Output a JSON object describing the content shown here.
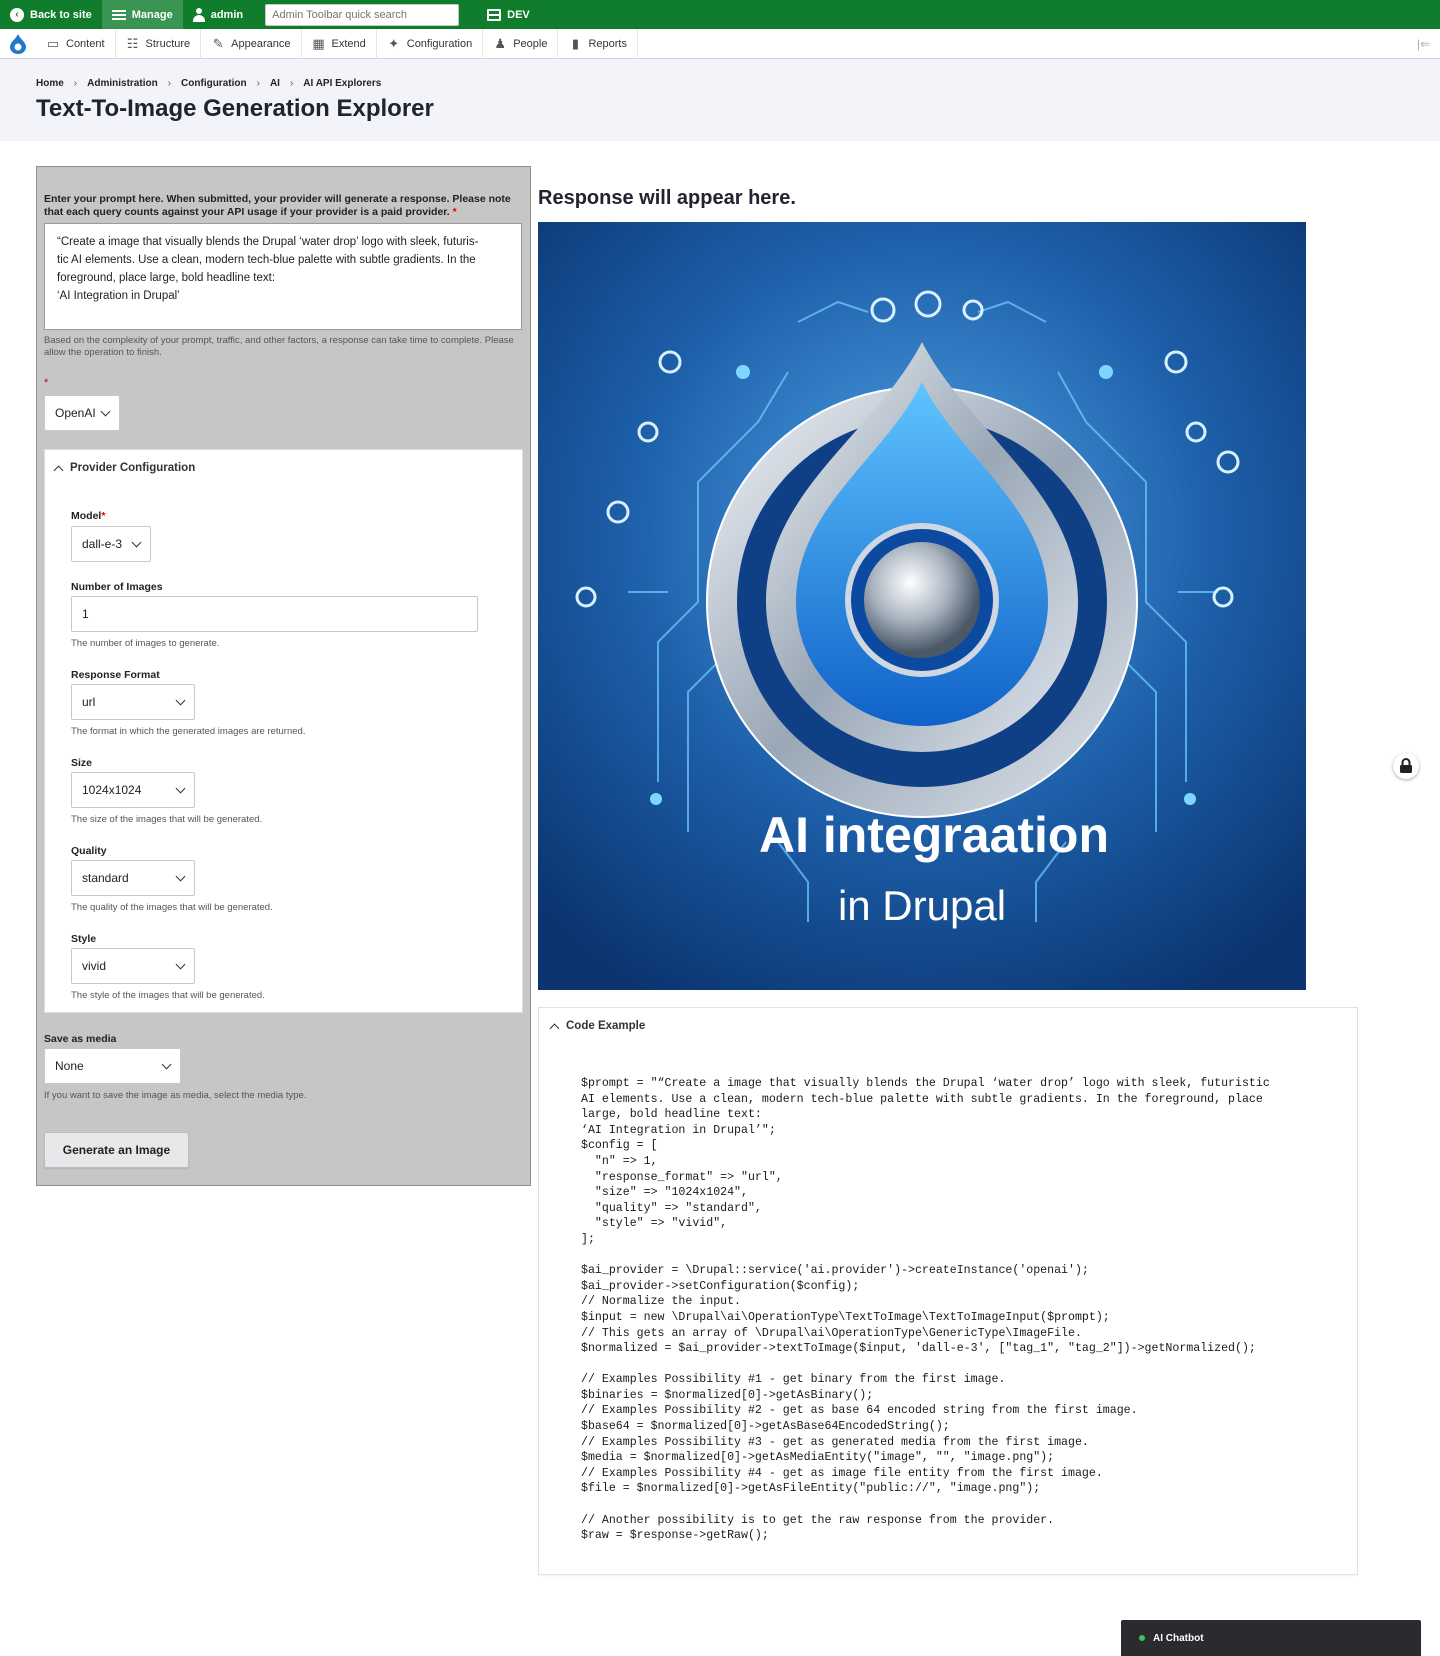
{
  "toolbar": {
    "back_label": "Back to site",
    "manage_label": "Manage",
    "user_label": "admin",
    "search_placeholder": "Admin Toolbar quick search",
    "env_label": "DEV"
  },
  "menu": {
    "items": [
      {
        "label": "Content",
        "icon": "document-icon"
      },
      {
        "label": "Structure",
        "icon": "structure-icon"
      },
      {
        "label": "Appearance",
        "icon": "wrench-brush-icon"
      },
      {
        "label": "Extend",
        "icon": "puzzle-icon"
      },
      {
        "label": "Configuration",
        "icon": "wrench-icon"
      },
      {
        "label": "People",
        "icon": "people-icon"
      },
      {
        "label": "Reports",
        "icon": "bar-chart-icon"
      }
    ]
  },
  "breadcrumb": [
    "Home",
    "Administration",
    "Configuration",
    "AI",
    "AI API Explorers"
  ],
  "page": {
    "title": "Text-To-Image Generation Explorer"
  },
  "form": {
    "prompt_label": "Enter your prompt here. When submitted, your provider will generate a response. Please note that each query counts against your API usage if your provider is a paid provider.",
    "prompt_value": "“Create a image that visually blends the Drupal ‘water drop’ logo with sleek, futuris-\ntic AI elements. Use a clean, modern tech-blue palette with subtle gradients. In the\nforeground, place large, bold headline text:\n‘AI Integration in Drupal’",
    "prompt_help": "Based on the complexity of your prompt, traffic, and other factors, a response can take time to complete. Please allow the operation to finish.",
    "provider_value": "OpenAI",
    "provider_config_label": "Provider Configuration",
    "model_label": "Model",
    "model_value": "dall-e-3",
    "num_images_label": "Number of Images",
    "num_images_value": "1",
    "num_images_help": "The number of images to generate.",
    "response_format_label": "Response Format",
    "response_format_value": "url",
    "response_format_help": "The format in which the generated images are returned.",
    "size_label": "Size",
    "size_value": "1024x1024",
    "size_help": "The size of the images that will be generated.",
    "quality_label": "Quality",
    "quality_value": "standard",
    "quality_help": "The quality of the images that will be generated.",
    "style_label": "Style",
    "style_value": "vivid",
    "style_help": "The style of the images that will be generated.",
    "save_media_label": "Save as media",
    "save_media_value": "None",
    "save_media_help": "If you want to save the image as media, select the media type.",
    "generate_label": "Generate an Image"
  },
  "response": {
    "title": "Response will appear here.",
    "image_text_line1": "AI integraation",
    "image_text_line2": "in Drupal"
  },
  "code": {
    "label": "Code Example",
    "text": "$prompt = \"“Create a image that visually blends the Drupal ‘water drop’ logo with sleek, futuristic\nAI elements. Use a clean, modern tech-blue palette with subtle gradients. In the foreground, place\nlarge, bold headline text:\n‘AI Integration in Drupal’\";\n$config = [\n  \"n\" => 1,\n  \"response_format\" => \"url\",\n  \"size\" => \"1024x1024\",\n  \"quality\" => \"standard\",\n  \"style\" => \"vivid\",\n];\n\n$ai_provider = \\Drupal::service('ai.provider')->createInstance('openai');\n$ai_provider->setConfiguration($config);\n// Normalize the input.\n$input = new \\Drupal\\ai\\OperationType\\TextToImage\\TextToImageInput($prompt);\n// This gets an array of \\Drupal\\ai\\OperationType\\GenericType\\ImageFile.\n$normalized = $ai_provider->textToImage($input, 'dall-e-3', [\"tag_1\", \"tag_2\"])->getNormalized();\n\n// Examples Possibility #1 - get binary from the first image.\n$binaries = $normalized[0]->getAsBinary();\n// Examples Possibility #2 - get as base 64 encoded string from the first image.\n$base64 = $normalized[0]->getAsBase64EncodedString();\n// Examples Possibility #3 - get as generated media from the first image.\n$media = $normalized[0]->getAsMediaEntity(\"image\", \"\", \"image.png\");\n// Examples Possibility #4 - get as image file entity from the first image.\n$file = $normalized[0]->getAsFileEntity(\"public://\", \"image.png\");\n\n// Another possibility is to get the raw response from the provider.\n$raw = $response->getRaw();"
  },
  "chatbot": {
    "label": "AI Chatbot"
  },
  "colors": {
    "toolbar_green": "#0f7d2c",
    "form_panel_gray": "#c6c6c6",
    "image_blue": "#1f62ad"
  }
}
